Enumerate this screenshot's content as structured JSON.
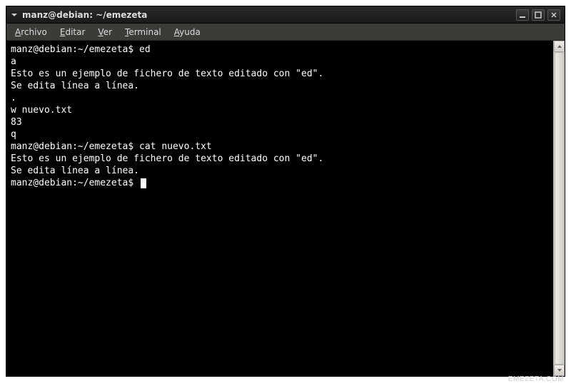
{
  "window": {
    "title": "manz@debian: ~/emezeta"
  },
  "menubar": {
    "items": [
      {
        "label": "Archivo",
        "mnemonic": "A"
      },
      {
        "label": "Editar",
        "mnemonic": "E"
      },
      {
        "label": "Ver",
        "mnemonic": "V"
      },
      {
        "label": "Terminal",
        "mnemonic": "T"
      },
      {
        "label": "Ayuda",
        "mnemonic": "A"
      }
    ]
  },
  "terminal": {
    "lines": [
      {
        "prompt": "manz@debian:~/emezeta$",
        "command": " ed"
      },
      {
        "text": "a"
      },
      {
        "text": "Esto es un ejemplo de fichero de texto editado con \"ed\"."
      },
      {
        "text": "Se edita línea a línea."
      },
      {
        "text": "."
      },
      {
        "text": "w nuevo.txt"
      },
      {
        "text": "83"
      },
      {
        "text": "q"
      },
      {
        "prompt": "manz@debian:~/emezeta$",
        "command": " cat nuevo.txt"
      },
      {
        "text": "Esto es un ejemplo de fichero de texto editado con \"ed\"."
      },
      {
        "text": "Se edita línea a línea."
      },
      {
        "prompt": "manz@debian:~/emezeta$",
        "command": " ",
        "cursor": true
      }
    ]
  },
  "watermark": "EMEZETA.COM"
}
